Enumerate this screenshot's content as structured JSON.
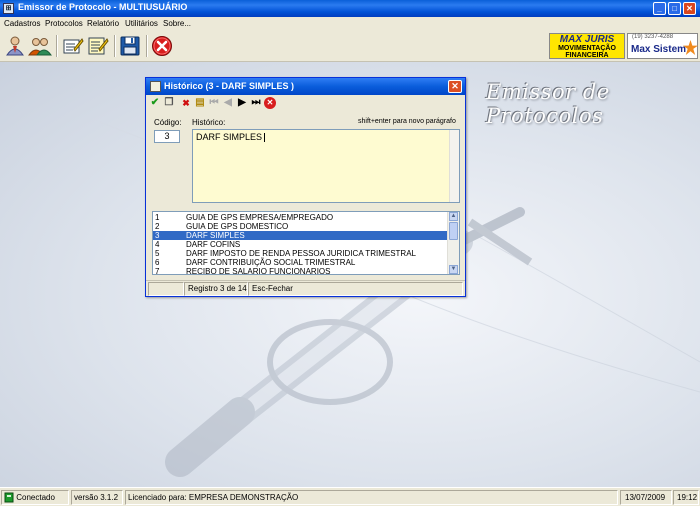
{
  "window": {
    "title": "Emissor de Protocolo - MULTIUSUÁRIO",
    "icon": "app-icon"
  },
  "menu": [
    "Cadastros",
    "Protocolos",
    "Relatório",
    "Utilitários",
    "Sobre..."
  ],
  "toolbar": {
    "icons": [
      "user-icon",
      "users-icon",
      "edit-form-icon",
      "edit-list-icon",
      "save-disk-icon",
      "cancel-icon"
    ]
  },
  "logos": {
    "maxjuris_name": "MAX JURIS",
    "maxjuris_sub1": "MOVIMENTAÇÃO",
    "maxjuris_sub2": "FINANCEIRA",
    "maxsistem_phone": "(19) 3237-4288",
    "maxsistem_name": "Max Sistem"
  },
  "desktop": {
    "brand": "Emissor de Protocolos"
  },
  "dialog": {
    "title": "Histórico (3 - DARF SIMPLES )",
    "code_label": "Código:",
    "code_value": "3",
    "history_label": "Histórico:",
    "hint": "shift+enter para novo parágrafo",
    "history_value": "DARF SIMPLES",
    "list": [
      {
        "num": "1",
        "desc": "GUIA DE GPS EMPRESA/EMPREGADO"
      },
      {
        "num": "2",
        "desc": "GUIA DE GPS DOMESTICO"
      },
      {
        "num": "3",
        "desc": "DARF SIMPLES"
      },
      {
        "num": "4",
        "desc": "DARF COFINS"
      },
      {
        "num": "5",
        "desc": "DARF IMPOSTO DE RENDA PESSOA JURIDICA TRIMESTRAL"
      },
      {
        "num": "6",
        "desc": "DARF CONTRIBUIÇÃO SOCIAL TRIMESTRAL"
      },
      {
        "num": "7",
        "desc": "RECIBO DE SALARIO FUNCIONARIOS"
      }
    ],
    "selected_index": 2,
    "status_record": "Registro 3 de 14",
    "status_esc": "Esc-Fechar"
  },
  "statusbar": {
    "connection": "Conectado",
    "version": "versão 3.1.2",
    "license": "Licenciado para: EMPRESA DEMONSTRAÇÃO",
    "date": "13/07/2009",
    "time": "19:12"
  }
}
